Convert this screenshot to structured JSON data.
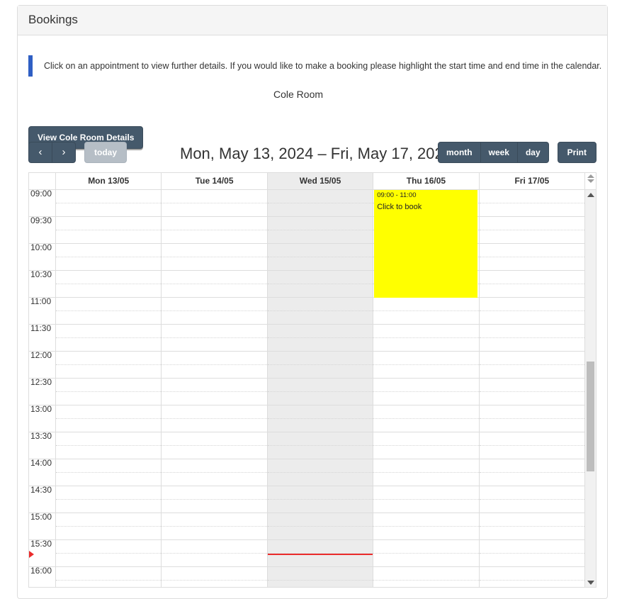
{
  "panel": {
    "title": "Bookings"
  },
  "info": {
    "text": "Click on an appointment to view further details. If you would like to make a booking please highlight the start time and end time in the calendar."
  },
  "room": {
    "name": "Cole Room",
    "details_button": "View Cole Room Details"
  },
  "toolbar": {
    "prev_label": "‹",
    "next_label": "›",
    "today_label": "today",
    "title": "Mon, May 13, 2024 – Fri, May 17, 2024",
    "views": [
      {
        "label": "month",
        "active": false
      },
      {
        "label": "week",
        "active": true
      },
      {
        "label": "day",
        "active": false
      }
    ],
    "print_label": "Print"
  },
  "calendar": {
    "days": [
      {
        "label": "Mon 13/05",
        "today": false
      },
      {
        "label": "Tue 14/05",
        "today": false
      },
      {
        "label": "Wed 15/05",
        "today": true
      },
      {
        "label": "Thu 16/05",
        "today": false
      },
      {
        "label": "Fri 17/05",
        "today": false
      }
    ],
    "times": [
      "09:00",
      "09:30",
      "10:00",
      "10:30",
      "11:00",
      "11:30",
      "12:00",
      "12:30",
      "13:00",
      "13:30",
      "14:00",
      "14:30",
      "15:00",
      "15:30",
      "16:00"
    ],
    "events": [
      {
        "day_index": 3,
        "time_range": "09:00 - 11:00",
        "title": "Click to book",
        "color": "#ffff00",
        "start": "09:00",
        "end": "11:00"
      }
    ],
    "now_indicator": {
      "day_index": 2,
      "time": "15:45",
      "color": "#ea2c2c"
    }
  },
  "colors": {
    "button": "#45596b",
    "button_disabled": "#b6bec6",
    "accent_bar": "#2f5fc4",
    "today_background": "#ececec",
    "event": "#ffff00"
  },
  "scrollbar": {
    "up_arrow": "scroll-up",
    "down_arrow": "scroll-down"
  }
}
